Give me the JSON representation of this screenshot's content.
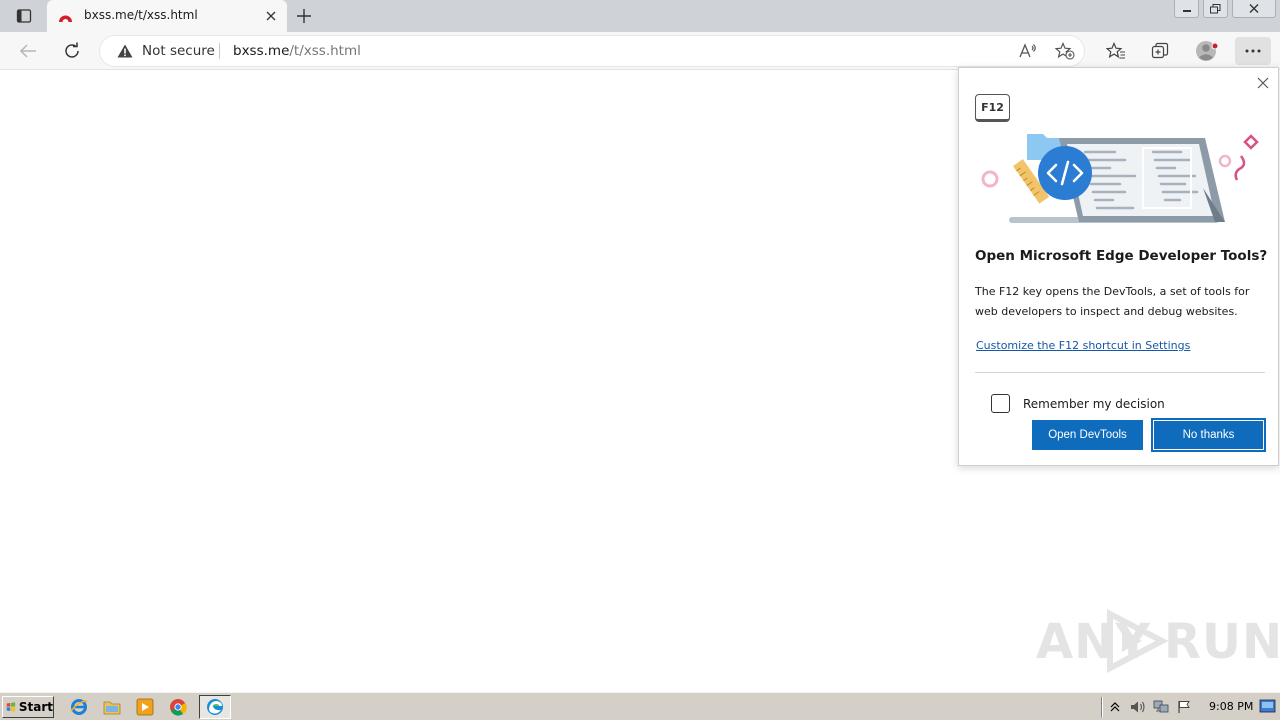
{
  "browser": {
    "tab": {
      "title": "bxss.me/t/xss.html"
    },
    "address": {
      "security_label": "Not secure",
      "url_host": "bxss.me",
      "url_path": "/t/xss.html"
    }
  },
  "flyout": {
    "badge": "F12",
    "title": "Open Microsoft Edge Developer Tools?",
    "description": "The F12 key opens the DevTools, a set of tools for web developers to inspect and debug websites.",
    "link": "Customize the F12 shortcut in Settings",
    "checkbox_label": "Remember my decision",
    "checkbox_checked": false,
    "primary_button": "Open DevTools",
    "secondary_button": "No thanks"
  },
  "watermark": {
    "text_left": "ANY",
    "text_right": "RUN"
  },
  "taskbar": {
    "start_label": "Start",
    "clock": "9:08 PM",
    "quick_launch": [
      "ie-icon",
      "folder-icon",
      "media-player-icon",
      "chrome-icon"
    ],
    "active_app": "edge-icon"
  },
  "colors": {
    "accent": "#0f6cbd",
    "tab_strip": "#cfd2d6",
    "taskbar": "#d4d0c8"
  }
}
